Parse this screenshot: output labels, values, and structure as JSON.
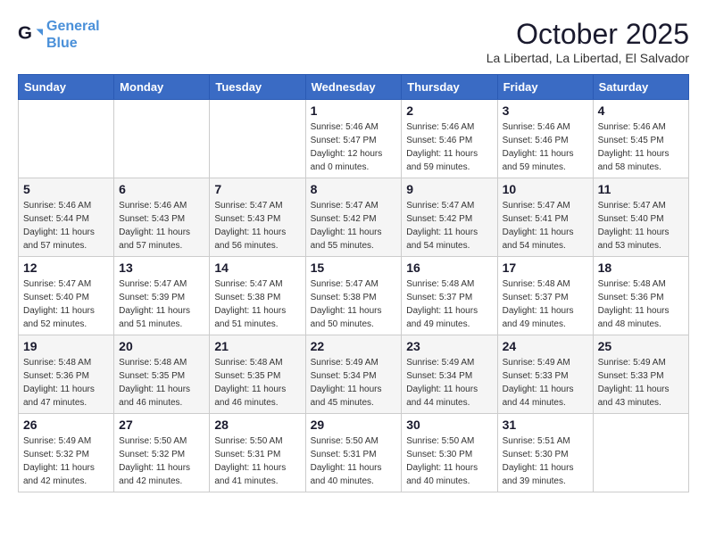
{
  "header": {
    "logo_line1": "General",
    "logo_line2": "Blue",
    "month": "October 2025",
    "location": "La Libertad, La Libertad, El Salvador"
  },
  "weekdays": [
    "Sunday",
    "Monday",
    "Tuesday",
    "Wednesday",
    "Thursday",
    "Friday",
    "Saturday"
  ],
  "weeks": [
    [
      {
        "day": "",
        "info": ""
      },
      {
        "day": "",
        "info": ""
      },
      {
        "day": "",
        "info": ""
      },
      {
        "day": "1",
        "info": "Sunrise: 5:46 AM\nSunset: 5:47 PM\nDaylight: 12 hours\nand 0 minutes."
      },
      {
        "day": "2",
        "info": "Sunrise: 5:46 AM\nSunset: 5:46 PM\nDaylight: 11 hours\nand 59 minutes."
      },
      {
        "day": "3",
        "info": "Sunrise: 5:46 AM\nSunset: 5:46 PM\nDaylight: 11 hours\nand 59 minutes."
      },
      {
        "day": "4",
        "info": "Sunrise: 5:46 AM\nSunset: 5:45 PM\nDaylight: 11 hours\nand 58 minutes."
      }
    ],
    [
      {
        "day": "5",
        "info": "Sunrise: 5:46 AM\nSunset: 5:44 PM\nDaylight: 11 hours\nand 57 minutes."
      },
      {
        "day": "6",
        "info": "Sunrise: 5:46 AM\nSunset: 5:43 PM\nDaylight: 11 hours\nand 57 minutes."
      },
      {
        "day": "7",
        "info": "Sunrise: 5:47 AM\nSunset: 5:43 PM\nDaylight: 11 hours\nand 56 minutes."
      },
      {
        "day": "8",
        "info": "Sunrise: 5:47 AM\nSunset: 5:42 PM\nDaylight: 11 hours\nand 55 minutes."
      },
      {
        "day": "9",
        "info": "Sunrise: 5:47 AM\nSunset: 5:42 PM\nDaylight: 11 hours\nand 54 minutes."
      },
      {
        "day": "10",
        "info": "Sunrise: 5:47 AM\nSunset: 5:41 PM\nDaylight: 11 hours\nand 54 minutes."
      },
      {
        "day": "11",
        "info": "Sunrise: 5:47 AM\nSunset: 5:40 PM\nDaylight: 11 hours\nand 53 minutes."
      }
    ],
    [
      {
        "day": "12",
        "info": "Sunrise: 5:47 AM\nSunset: 5:40 PM\nDaylight: 11 hours\nand 52 minutes."
      },
      {
        "day": "13",
        "info": "Sunrise: 5:47 AM\nSunset: 5:39 PM\nDaylight: 11 hours\nand 51 minutes."
      },
      {
        "day": "14",
        "info": "Sunrise: 5:47 AM\nSunset: 5:38 PM\nDaylight: 11 hours\nand 51 minutes."
      },
      {
        "day": "15",
        "info": "Sunrise: 5:47 AM\nSunset: 5:38 PM\nDaylight: 11 hours\nand 50 minutes."
      },
      {
        "day": "16",
        "info": "Sunrise: 5:48 AM\nSunset: 5:37 PM\nDaylight: 11 hours\nand 49 minutes."
      },
      {
        "day": "17",
        "info": "Sunrise: 5:48 AM\nSunset: 5:37 PM\nDaylight: 11 hours\nand 49 minutes."
      },
      {
        "day": "18",
        "info": "Sunrise: 5:48 AM\nSunset: 5:36 PM\nDaylight: 11 hours\nand 48 minutes."
      }
    ],
    [
      {
        "day": "19",
        "info": "Sunrise: 5:48 AM\nSunset: 5:36 PM\nDaylight: 11 hours\nand 47 minutes."
      },
      {
        "day": "20",
        "info": "Sunrise: 5:48 AM\nSunset: 5:35 PM\nDaylight: 11 hours\nand 46 minutes."
      },
      {
        "day": "21",
        "info": "Sunrise: 5:48 AM\nSunset: 5:35 PM\nDaylight: 11 hours\nand 46 minutes."
      },
      {
        "day": "22",
        "info": "Sunrise: 5:49 AM\nSunset: 5:34 PM\nDaylight: 11 hours\nand 45 minutes."
      },
      {
        "day": "23",
        "info": "Sunrise: 5:49 AM\nSunset: 5:34 PM\nDaylight: 11 hours\nand 44 minutes."
      },
      {
        "day": "24",
        "info": "Sunrise: 5:49 AM\nSunset: 5:33 PM\nDaylight: 11 hours\nand 44 minutes."
      },
      {
        "day": "25",
        "info": "Sunrise: 5:49 AM\nSunset: 5:33 PM\nDaylight: 11 hours\nand 43 minutes."
      }
    ],
    [
      {
        "day": "26",
        "info": "Sunrise: 5:49 AM\nSunset: 5:32 PM\nDaylight: 11 hours\nand 42 minutes."
      },
      {
        "day": "27",
        "info": "Sunrise: 5:50 AM\nSunset: 5:32 PM\nDaylight: 11 hours\nand 42 minutes."
      },
      {
        "day": "28",
        "info": "Sunrise: 5:50 AM\nSunset: 5:31 PM\nDaylight: 11 hours\nand 41 minutes."
      },
      {
        "day": "29",
        "info": "Sunrise: 5:50 AM\nSunset: 5:31 PM\nDaylight: 11 hours\nand 40 minutes."
      },
      {
        "day": "30",
        "info": "Sunrise: 5:50 AM\nSunset: 5:30 PM\nDaylight: 11 hours\nand 40 minutes."
      },
      {
        "day": "31",
        "info": "Sunrise: 5:51 AM\nSunset: 5:30 PM\nDaylight: 11 hours\nand 39 minutes."
      },
      {
        "day": "",
        "info": ""
      }
    ]
  ]
}
